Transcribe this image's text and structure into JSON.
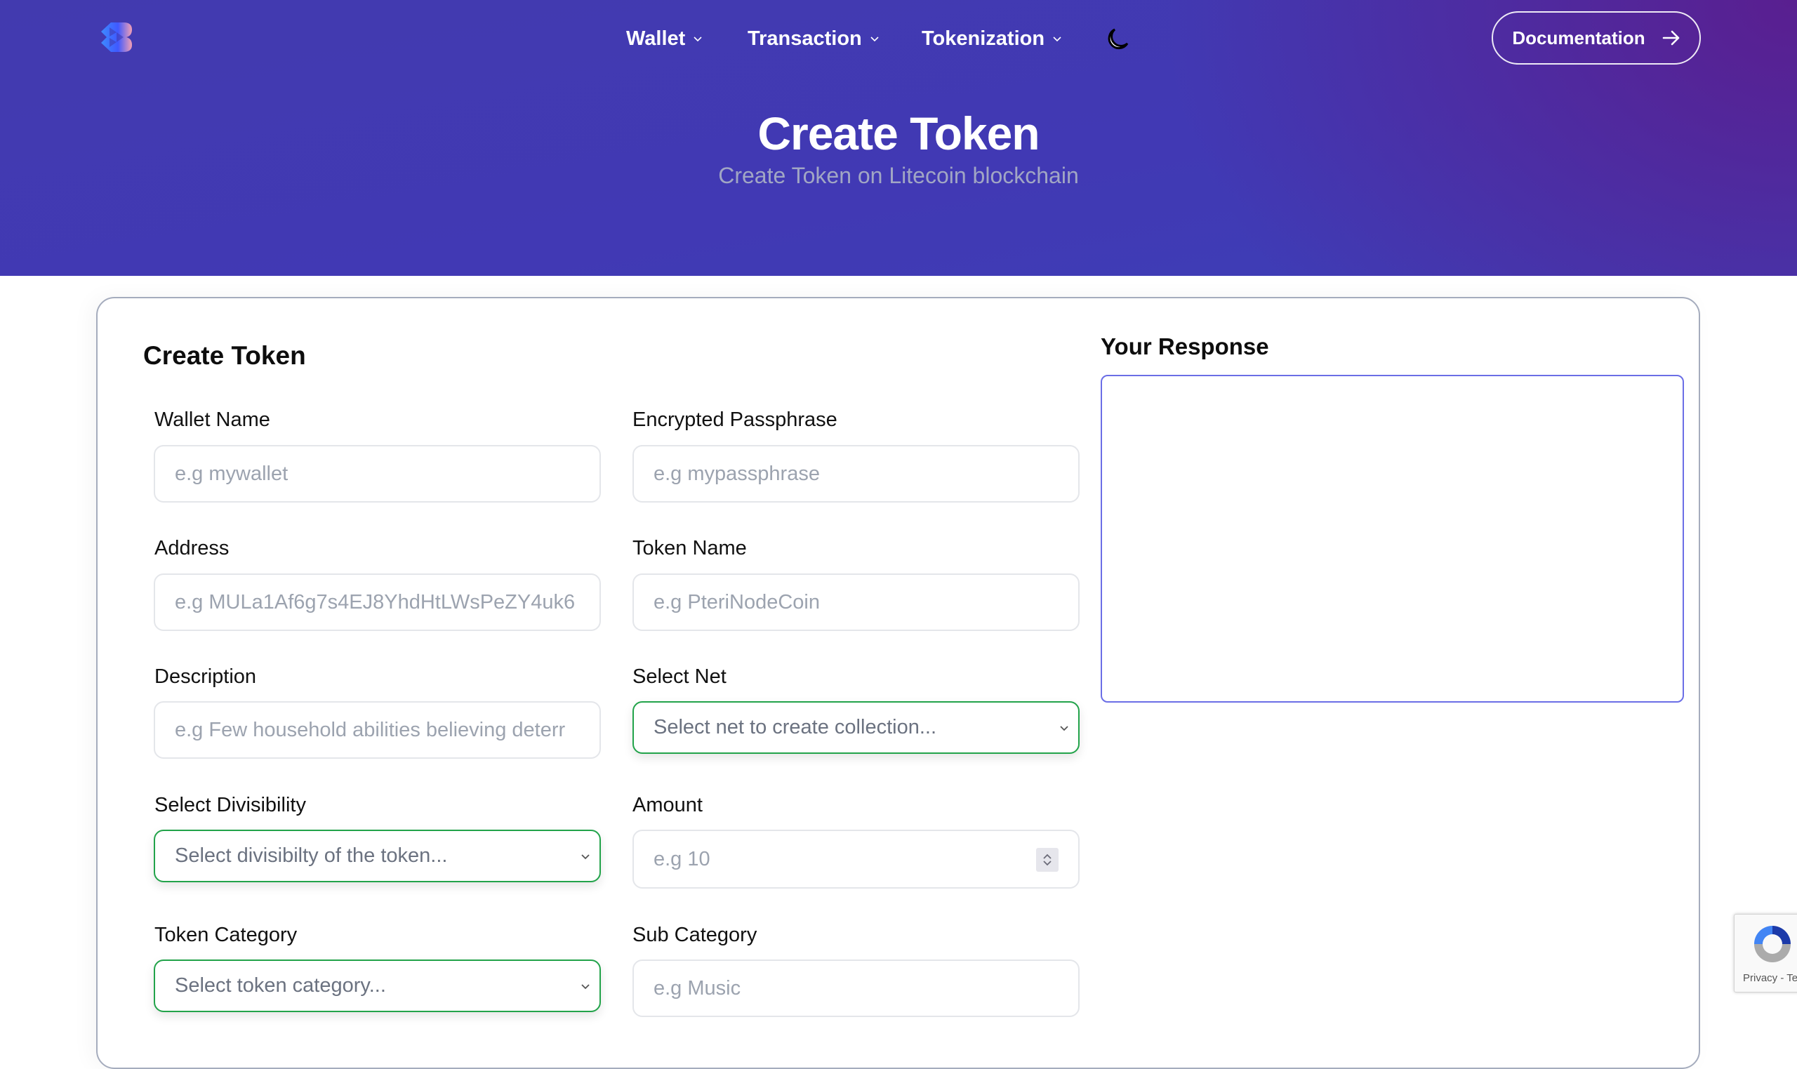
{
  "header": {
    "logo": "brand-logo",
    "nav": [
      {
        "label": "Wallet",
        "icon": "chevron-down-icon"
      },
      {
        "label": "Transaction",
        "icon": "chevron-down-icon"
      },
      {
        "label": "Tokenization",
        "icon": "chevron-down-icon"
      }
    ],
    "theme_toggle_icon": "moon-icon",
    "documentation_label": "Documentation",
    "documentation_icon": "arrow-right-icon",
    "title": "Create Token",
    "subtitle": "Create Token on Litecoin blockchain"
  },
  "form": {
    "title": "Create Token",
    "fields": {
      "wallet_name": {
        "label": "Wallet Name",
        "placeholder": "e.g mywallet"
      },
      "passphrase": {
        "label": "Encrypted Passphrase",
        "placeholder": "e.g mypassphrase"
      },
      "address": {
        "label": "Address",
        "placeholder": "e.g MULa1Af6g7s4EJ8YhdHtLWsPeZY4uk6"
      },
      "token_name": {
        "label": "Token Name",
        "placeholder": "e.g PteriNodeCoin"
      },
      "description": {
        "label": "Description",
        "placeholder": "e.g Few household abilities believing deterr"
      },
      "select_net": {
        "label": "Select Net",
        "value": "Select net to create collection..."
      },
      "divisibility": {
        "label": "Select Divisibility",
        "value": "Select divisibilty of the token..."
      },
      "amount": {
        "label": "Amount",
        "placeholder": "e.g 10"
      },
      "token_category": {
        "label": "Token Category",
        "value": "Select token category..."
      },
      "sub_category": {
        "label": "Sub Category",
        "placeholder": "e.g Music"
      }
    }
  },
  "response": {
    "title": "Your Response",
    "value": ""
  },
  "recaptcha": {
    "text": "Privacy - Terms"
  },
  "colors": {
    "header_bg": "#4139b4",
    "header_accent": "#5c1c8c",
    "select_border": "#22a34a",
    "response_border": "#6b6ee6",
    "card_border": "#a5acbd"
  }
}
